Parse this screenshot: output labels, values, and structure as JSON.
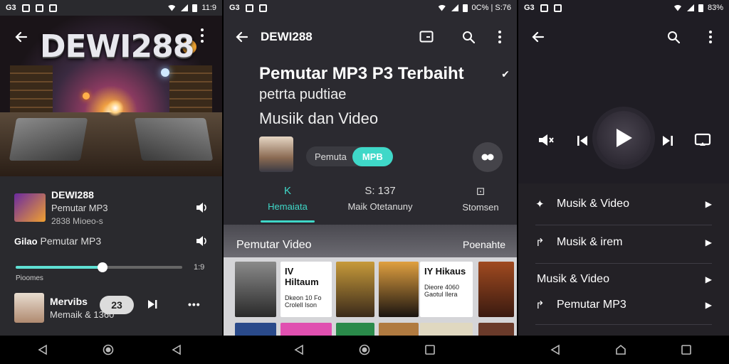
{
  "panel1": {
    "status": {
      "left": "G3",
      "right": "11:9"
    },
    "hero_title": "DEWI288",
    "track1": {
      "title": "DEWI288",
      "sub": "Pemutar MP3",
      "sub2": "2838 Mioeo-s"
    },
    "track2": {
      "prefix": "Gilao",
      "label": "Pemutar MP3"
    },
    "progress": {
      "percent": 52,
      "start": "Pioomes",
      "end": "1:9"
    },
    "track3": {
      "title": "Mervibs",
      "sub": "Memaik & 1360",
      "badge": "23"
    },
    "more_label": "•••"
  },
  "panel2": {
    "status": {
      "left": "G3",
      "right": "0C% | S:76"
    },
    "header_title": "DEWI288",
    "headline": "Pemutar MP3 P3 Terbaiht",
    "line2": "petrta pudtiae",
    "line3": "Musiik dan Video",
    "pill_label": "Pemuta",
    "pill_active": "MPB",
    "tabs": [
      {
        "icon": "K",
        "label": "Hemaiata",
        "active": true
      },
      {
        "icon": "S: 137",
        "label": "Maik Otetanuny",
        "active": false
      },
      {
        "icon": "⊡",
        "label": "Stomsen",
        "active": false
      }
    ],
    "video_section": {
      "title": "Pemutar Video",
      "more": "Poenahte"
    },
    "cards": [
      {
        "big": "",
        "small": ""
      },
      {
        "big": "IV Hiltaum",
        "small": "Dkeon 10 Fo Crolell Ison"
      },
      {
        "big": "",
        "small": ""
      },
      {
        "big": "",
        "small": ""
      },
      {
        "big": "IY Hikaus",
        "small": "Dieore 4060 Gaotul Ilera"
      },
      {
        "big": "",
        "small": ""
      }
    ]
  },
  "panel3": {
    "status": {
      "left": "G3",
      "right": "83%"
    },
    "items": [
      {
        "icon": "✦",
        "label": "Musik & Video"
      },
      {
        "icon": "↱",
        "label": "Musik & irem"
      },
      {
        "icon": "",
        "label": "Musik & Video"
      },
      {
        "icon": "↱",
        "label": "Pemutar MP3"
      }
    ],
    "flag": "▶"
  },
  "colors": {
    "accent": "#3fd8c8"
  }
}
